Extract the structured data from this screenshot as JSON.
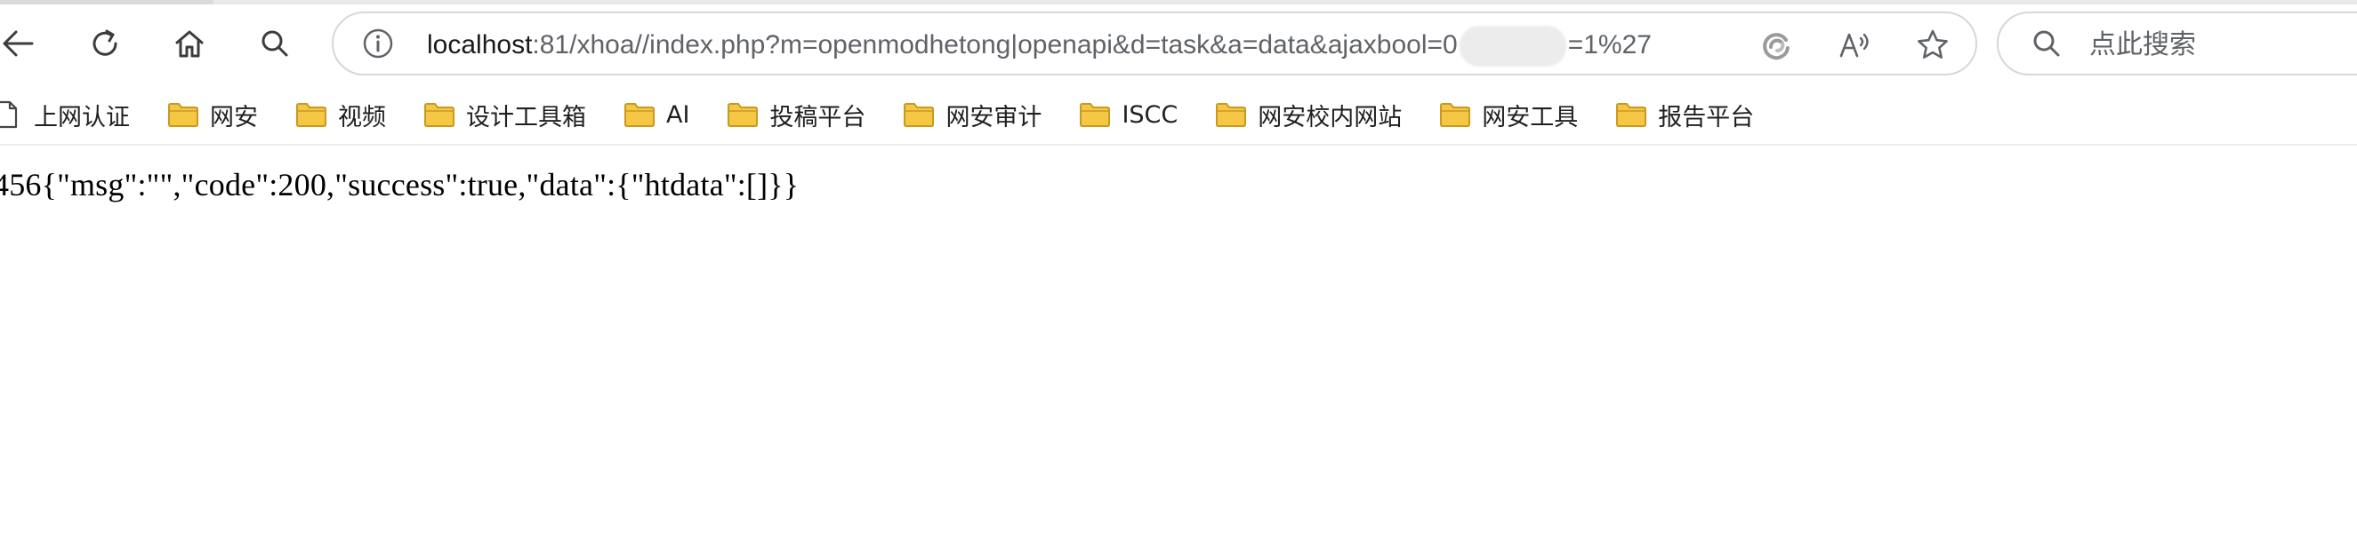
{
  "toolbar": {
    "back_icon": "back-arrow-icon",
    "reload_icon": "reload-icon",
    "home_icon": "home-icon",
    "search_icon": "search-icon"
  },
  "address_bar": {
    "info_icon": "info-icon",
    "url_host": "localhost",
    "url_rest_before": ":81/xhoa//index.php?m=openmodhetong|openapi&d=task&a=data&ajaxbool=0",
    "url_rest_after": "=1%27",
    "url_redacted": true,
    "icons": [
      "edge-refresh-icon",
      "read-aloud-icon",
      "favorite-star-icon"
    ]
  },
  "search": {
    "placeholder": "点此搜索",
    "icon": "search-icon"
  },
  "bookmarks": [
    {
      "label": "上网认证",
      "icon": "page-icon"
    },
    {
      "label": "网安",
      "icon": "folder-icon"
    },
    {
      "label": "视频",
      "icon": "folder-icon"
    },
    {
      "label": "设计工具箱",
      "icon": "folder-icon"
    },
    {
      "label": "AI",
      "icon": "folder-icon"
    },
    {
      "label": "投稿平台",
      "icon": "folder-icon"
    },
    {
      "label": "网安审计",
      "icon": "folder-icon"
    },
    {
      "label": "ISCC",
      "icon": "folder-icon"
    },
    {
      "label": "网安校内网站",
      "icon": "folder-icon"
    },
    {
      "label": "网安工具",
      "icon": "folder-icon"
    },
    {
      "label": "报告平台",
      "icon": "folder-icon"
    }
  ],
  "content": {
    "response_text": "456{\"msg\":\"\",\"code\":200,\"success\":true,\"data\":{\"htdata\":[]}}"
  },
  "colors": {
    "folder": "#f6c744",
    "folder_outline": "#c89a1e",
    "icon_gray": "#5f6368",
    "border": "#d7d7d7"
  }
}
